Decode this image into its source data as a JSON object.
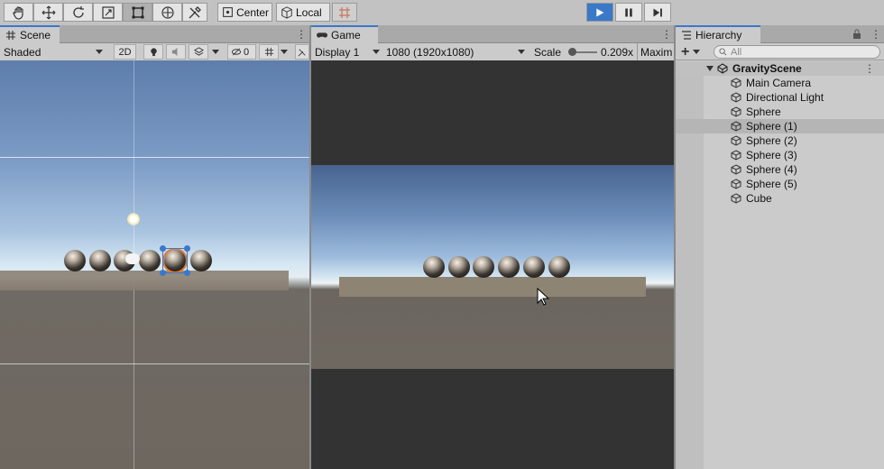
{
  "toolbar": {
    "pivot_label": "Center",
    "space_label": "Local",
    "playing": true,
    "accent": "#3a78c9"
  },
  "scene": {
    "tab_label": "Scene",
    "draw_mode": "Shaded",
    "mode_2d": "2D",
    "hidden_count": "0"
  },
  "game": {
    "tab_label": "Game",
    "display": "Display 1",
    "resolution": "1080 (1920x1080)",
    "scale_label": "Scale",
    "scale_value": "0.209x",
    "maximize": "Maxim"
  },
  "hierarchy": {
    "tab_label": "Hierarchy",
    "search_placeholder": "All",
    "scene_name": "GravityScene",
    "items": [
      {
        "label": "Main Camera"
      },
      {
        "label": "Directional Light"
      },
      {
        "label": "Sphere"
      },
      {
        "label": "Sphere (1)",
        "selected": true
      },
      {
        "label": "Sphere (2)"
      },
      {
        "label": "Sphere (3)"
      },
      {
        "label": "Sphere (4)"
      },
      {
        "label": "Sphere (5)"
      },
      {
        "label": "Cube"
      }
    ]
  }
}
